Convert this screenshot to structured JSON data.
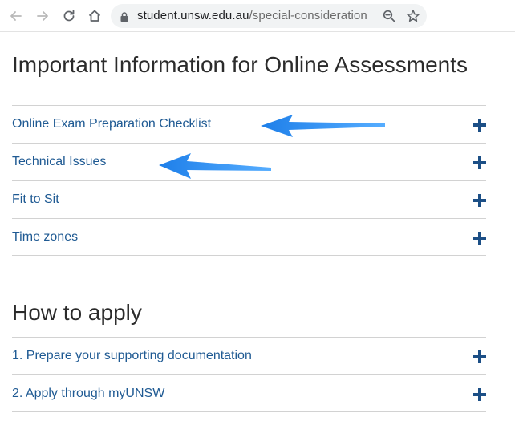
{
  "browser": {
    "url_host": "student.unsw.edu.au",
    "url_path": "/special-consideration",
    "icons": [
      "back-arrow-icon",
      "forward-arrow-icon",
      "reload-icon",
      "home-icon",
      "lock-icon",
      "zoom-icon",
      "star-icon"
    ]
  },
  "sections": [
    {
      "title": "Important Information for Online Assessments",
      "items": [
        "Online Exam Preparation Checklist",
        "Technical Issues",
        "Fit to Sit",
        "Time zones"
      ]
    },
    {
      "title": "How to apply",
      "items": [
        "1. Prepare your supporting documentation",
        "2. Apply through myUNSW"
      ]
    }
  ],
  "colors": {
    "link": "#1f5a93",
    "plus": "#1c4f86",
    "annotation_arrow": "#2f8df0"
  }
}
